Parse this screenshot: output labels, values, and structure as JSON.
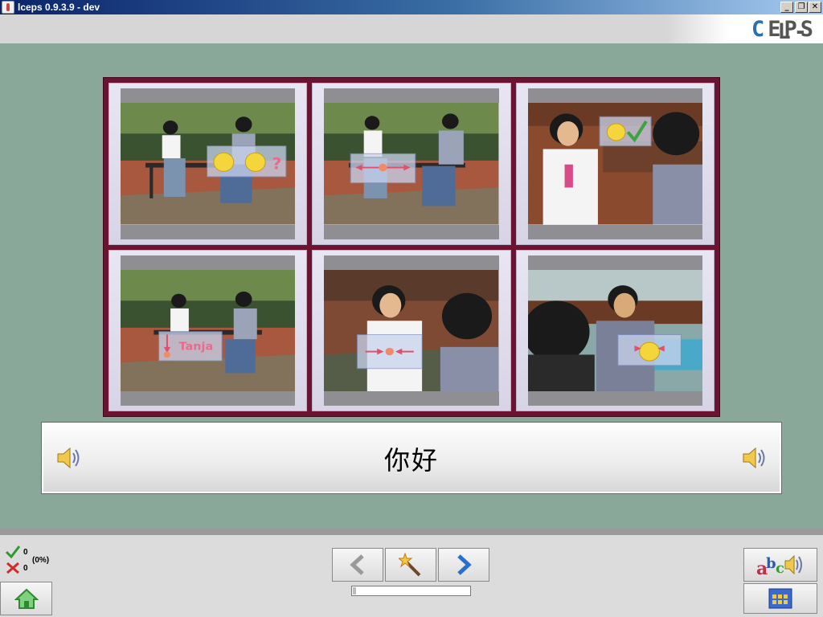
{
  "window": {
    "title": "lceps 0.9.3.9 - dev",
    "minimize_label": "_",
    "restore_label": "❐",
    "close_label": "✕"
  },
  "header": {
    "logo_left": "L-",
    "logo_accent": "C",
    "logo_right": "EPS"
  },
  "grid": {
    "cards": [
      {
        "name": "card-1",
        "overlay": "faces-question-icon"
      },
      {
        "name": "card-2",
        "overlay": "arrows-apart-icon"
      },
      {
        "name": "card-3",
        "overlay": "smile-check-icon"
      },
      {
        "name": "card-4",
        "overlay": "name-tag-icon",
        "label": "Tanja"
      },
      {
        "name": "card-5",
        "overlay": "arrows-inward-icon"
      },
      {
        "name": "card-6",
        "overlay": "face-inward-icon"
      }
    ]
  },
  "sentence": {
    "text": "你好",
    "left_icon": "speaker-icon",
    "right_icon": "speaker-icon"
  },
  "score": {
    "correct": "0",
    "wrong": "0",
    "percent": "(0%)"
  },
  "progress": {
    "fraction": 0.03
  },
  "colors": {
    "background": "#8aa899",
    "grid_border": "#6b1330",
    "accent": "#2a6fb0"
  }
}
